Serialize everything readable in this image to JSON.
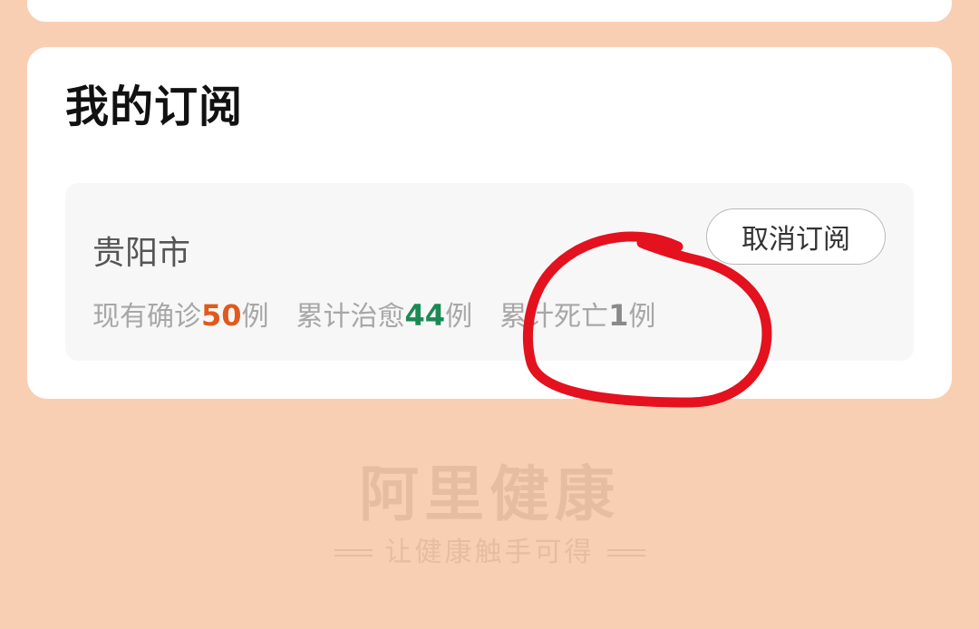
{
  "subscription": {
    "title": "我的订阅",
    "items": [
      {
        "city": "贵阳市",
        "unsubscribe_label": "取消订阅",
        "stats": [
          {
            "label": "现有确诊",
            "value": "50",
            "unit": "例",
            "color": "#e05a1c"
          },
          {
            "label": "累计治愈",
            "value": "44",
            "unit": "例",
            "color": "#1a8a55"
          },
          {
            "label": "累计死亡",
            "value": "1",
            "unit": "例",
            "color": "#8a8a8a"
          }
        ]
      }
    ]
  },
  "footer": {
    "brand": "阿里健康",
    "slogan": "让健康触手可得"
  },
  "colors": {
    "page_background": "#f9cfb4",
    "annotation": "#e3121e"
  }
}
